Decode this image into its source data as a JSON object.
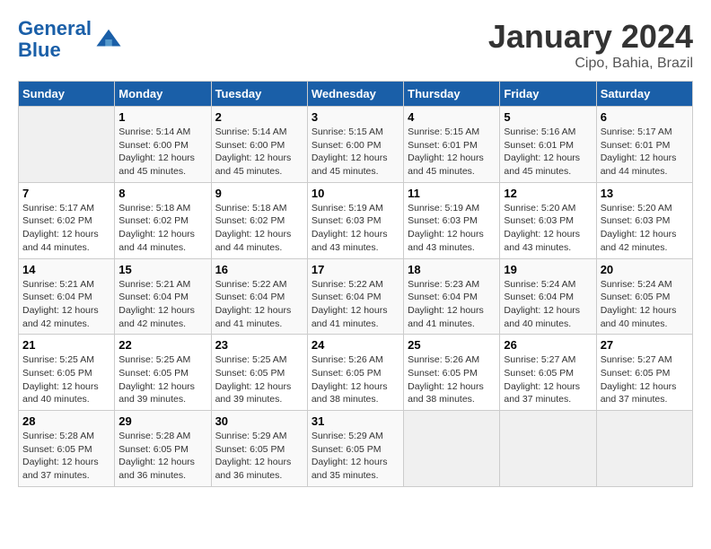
{
  "header": {
    "logo_line1": "General",
    "logo_line2": "Blue",
    "title": "January 2024",
    "subtitle": "Cipo, Bahia, Brazil"
  },
  "days_of_week": [
    "Sunday",
    "Monday",
    "Tuesday",
    "Wednesday",
    "Thursday",
    "Friday",
    "Saturday"
  ],
  "weeks": [
    [
      {
        "day": "",
        "empty": true
      },
      {
        "day": "1",
        "sunrise": "5:14 AM",
        "sunset": "6:00 PM",
        "daylight": "12 hours and 45 minutes."
      },
      {
        "day": "2",
        "sunrise": "5:14 AM",
        "sunset": "6:00 PM",
        "daylight": "12 hours and 45 minutes."
      },
      {
        "day": "3",
        "sunrise": "5:15 AM",
        "sunset": "6:00 PM",
        "daylight": "12 hours and 45 minutes."
      },
      {
        "day": "4",
        "sunrise": "5:15 AM",
        "sunset": "6:01 PM",
        "daylight": "12 hours and 45 minutes."
      },
      {
        "day": "5",
        "sunrise": "5:16 AM",
        "sunset": "6:01 PM",
        "daylight": "12 hours and 45 minutes."
      },
      {
        "day": "6",
        "sunrise": "5:17 AM",
        "sunset": "6:01 PM",
        "daylight": "12 hours and 44 minutes."
      }
    ],
    [
      {
        "day": "7",
        "sunrise": "5:17 AM",
        "sunset": "6:02 PM",
        "daylight": "12 hours and 44 minutes."
      },
      {
        "day": "8",
        "sunrise": "5:18 AM",
        "sunset": "6:02 PM",
        "daylight": "12 hours and 44 minutes."
      },
      {
        "day": "9",
        "sunrise": "5:18 AM",
        "sunset": "6:02 PM",
        "daylight": "12 hours and 44 minutes."
      },
      {
        "day": "10",
        "sunrise": "5:19 AM",
        "sunset": "6:03 PM",
        "daylight": "12 hours and 43 minutes."
      },
      {
        "day": "11",
        "sunrise": "5:19 AM",
        "sunset": "6:03 PM",
        "daylight": "12 hours and 43 minutes."
      },
      {
        "day": "12",
        "sunrise": "5:20 AM",
        "sunset": "6:03 PM",
        "daylight": "12 hours and 43 minutes."
      },
      {
        "day": "13",
        "sunrise": "5:20 AM",
        "sunset": "6:03 PM",
        "daylight": "12 hours and 42 minutes."
      }
    ],
    [
      {
        "day": "14",
        "sunrise": "5:21 AM",
        "sunset": "6:04 PM",
        "daylight": "12 hours and 42 minutes."
      },
      {
        "day": "15",
        "sunrise": "5:21 AM",
        "sunset": "6:04 PM",
        "daylight": "12 hours and 42 minutes."
      },
      {
        "day": "16",
        "sunrise": "5:22 AM",
        "sunset": "6:04 PM",
        "daylight": "12 hours and 41 minutes."
      },
      {
        "day": "17",
        "sunrise": "5:22 AM",
        "sunset": "6:04 PM",
        "daylight": "12 hours and 41 minutes."
      },
      {
        "day": "18",
        "sunrise": "5:23 AM",
        "sunset": "6:04 PM",
        "daylight": "12 hours and 41 minutes."
      },
      {
        "day": "19",
        "sunrise": "5:24 AM",
        "sunset": "6:04 PM",
        "daylight": "12 hours and 40 minutes."
      },
      {
        "day": "20",
        "sunrise": "5:24 AM",
        "sunset": "6:05 PM",
        "daylight": "12 hours and 40 minutes."
      }
    ],
    [
      {
        "day": "21",
        "sunrise": "5:25 AM",
        "sunset": "6:05 PM",
        "daylight": "12 hours and 40 minutes."
      },
      {
        "day": "22",
        "sunrise": "5:25 AM",
        "sunset": "6:05 PM",
        "daylight": "12 hours and 39 minutes."
      },
      {
        "day": "23",
        "sunrise": "5:25 AM",
        "sunset": "6:05 PM",
        "daylight": "12 hours and 39 minutes."
      },
      {
        "day": "24",
        "sunrise": "5:26 AM",
        "sunset": "6:05 PM",
        "daylight": "12 hours and 38 minutes."
      },
      {
        "day": "25",
        "sunrise": "5:26 AM",
        "sunset": "6:05 PM",
        "daylight": "12 hours and 38 minutes."
      },
      {
        "day": "26",
        "sunrise": "5:27 AM",
        "sunset": "6:05 PM",
        "daylight": "12 hours and 37 minutes."
      },
      {
        "day": "27",
        "sunrise": "5:27 AM",
        "sunset": "6:05 PM",
        "daylight": "12 hours and 37 minutes."
      }
    ],
    [
      {
        "day": "28",
        "sunrise": "5:28 AM",
        "sunset": "6:05 PM",
        "daylight": "12 hours and 37 minutes."
      },
      {
        "day": "29",
        "sunrise": "5:28 AM",
        "sunset": "6:05 PM",
        "daylight": "12 hours and 36 minutes."
      },
      {
        "day": "30",
        "sunrise": "5:29 AM",
        "sunset": "6:05 PM",
        "daylight": "12 hours and 36 minutes."
      },
      {
        "day": "31",
        "sunrise": "5:29 AM",
        "sunset": "6:05 PM",
        "daylight": "12 hours and 35 minutes."
      },
      {
        "day": "",
        "empty": true
      },
      {
        "day": "",
        "empty": true
      },
      {
        "day": "",
        "empty": true
      }
    ]
  ]
}
